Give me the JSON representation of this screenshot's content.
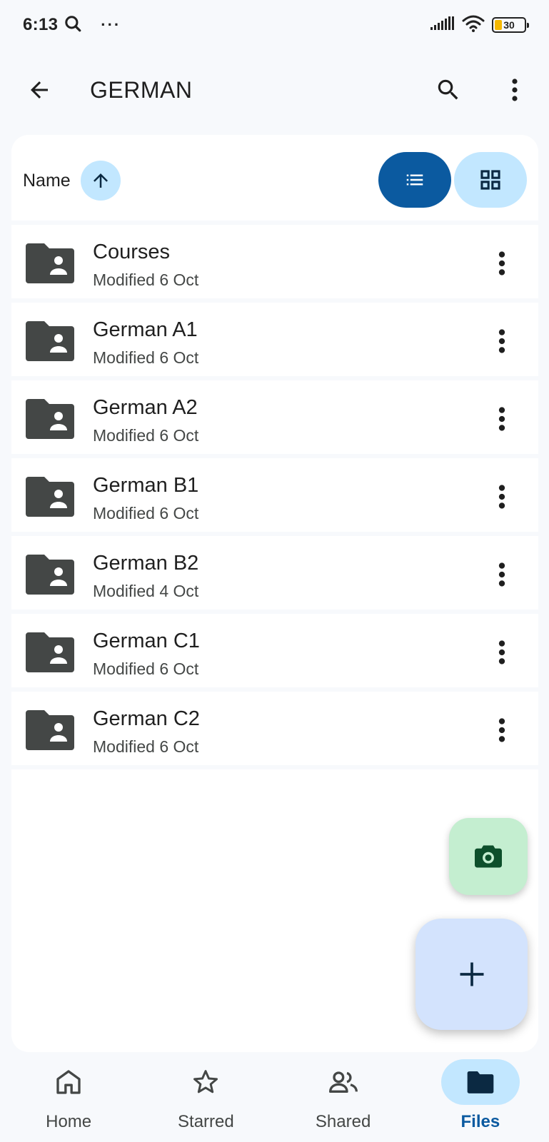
{
  "status_bar": {
    "time": "6:13",
    "overflow": "···",
    "battery": "30"
  },
  "app_bar": {
    "title": "GERMAN"
  },
  "sort": {
    "label": "Name",
    "direction": "ascending"
  },
  "view_toggle": {
    "active": "list"
  },
  "files": [
    {
      "name": "Courses",
      "meta": "Modified 6 Oct",
      "type": "shared-folder"
    },
    {
      "name": "German A1",
      "meta": "Modified 6 Oct",
      "type": "shared-folder"
    },
    {
      "name": "German A2",
      "meta": "Modified 6 Oct",
      "type": "shared-folder"
    },
    {
      "name": "German B1",
      "meta": "Modified 6 Oct",
      "type": "shared-folder"
    },
    {
      "name": "German B2",
      "meta": "Modified 4 Oct",
      "type": "shared-folder"
    },
    {
      "name": "German C1",
      "meta": "Modified 6 Oct",
      "type": "shared-folder"
    },
    {
      "name": "German C2",
      "meta": "Modified 6 Oct",
      "type": "shared-folder"
    }
  ],
  "bottom_nav": {
    "items": [
      {
        "label": "Home",
        "icon": "home-icon",
        "active": false
      },
      {
        "label": "Starred",
        "icon": "star-icon",
        "active": false
      },
      {
        "label": "Shared",
        "icon": "people-icon",
        "active": false
      },
      {
        "label": "Files",
        "icon": "folder-icon",
        "active": true
      }
    ]
  },
  "colors": {
    "background": "#f7f9fc",
    "accent": "#0b5aa0",
    "accent_light": "#c2e7ff",
    "camera_fab": "#c4eed0",
    "new_fab": "#d3e3fd",
    "folder": "#444746"
  }
}
